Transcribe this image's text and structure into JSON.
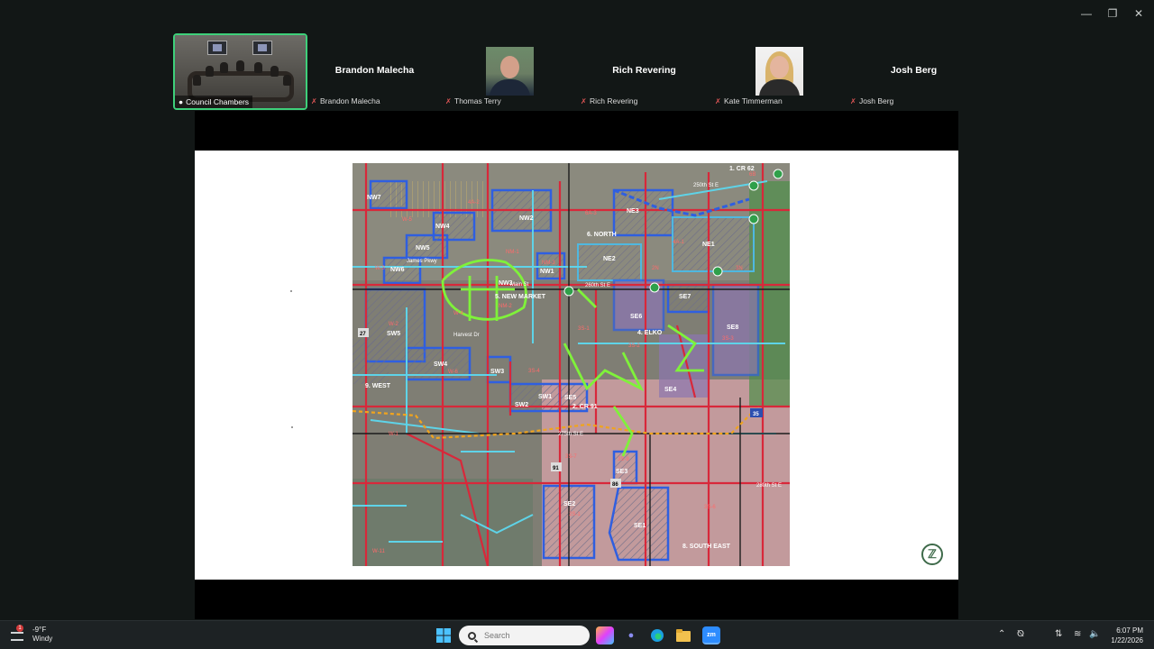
{
  "window": {
    "controls": {
      "minimize": "—",
      "maximize": "❐",
      "close": "✕"
    }
  },
  "participants": {
    "active": {
      "label": "Council Chambers"
    },
    "tiles": [
      {
        "big_name": "Brandon Malecha",
        "label": "Brandon Malecha",
        "has_video": false
      },
      {
        "big_name": "",
        "label": "Thomas Terry",
        "has_video": true
      },
      {
        "big_name": "Rich Revering",
        "label": "Rich Revering",
        "has_video": false
      },
      {
        "big_name": "",
        "label": "Kate Timmerman",
        "has_video": true
      },
      {
        "big_name": "Josh Berg",
        "label": "Josh Berg",
        "has_video": false
      }
    ]
  },
  "map": {
    "roads": {
      "cr62": "CR 62",
      "s250": "250th St E",
      "s260": "260th St E",
      "s275": "275th St E",
      "s280": "280th St E",
      "dakota": "Dakota Ave",
      "natchez": "Natchez Ave",
      "james": "James Pkwy",
      "harvest": "Harvest Dr",
      "dupont": "Dupont Ave",
      "main": "Main St",
      "cr91": "CR 91",
      "i35": "35",
      "hwy": "91",
      "h86": "86",
      "h27": "27"
    },
    "areas": {
      "north": "6. NORTH",
      "new_market": "5. NEW MARKET",
      "elko": "4. ELKO",
      "west": "9. WEST",
      "cr91_area": "2. CR 91",
      "south_east": "8. SOUTH EAST",
      "cr62_area": "1. CR 62"
    },
    "districts": {
      "nw7": "NW7",
      "nw2": "NW2",
      "nw4": "NW4",
      "nw5": "NW5",
      "nw6": "NW6",
      "nw3": "NW3",
      "nw1": "NW1",
      "ne3": "NE3",
      "ne1": "NE1",
      "ne2": "NE2",
      "se7": "SE7",
      "se6": "SE6",
      "se8": "SE8",
      "se4": "SE4",
      "se5": "SE5",
      "se3": "SE3",
      "se2": "SE2",
      "se1": "SE1",
      "sw5": "SW5",
      "sw4": "SW4",
      "sw3": "SW3",
      "sw1": "SW1",
      "sw2": "SW2"
    },
    "codes": {
      "w5": "W-5",
      "w3": "W-3",
      "w2": "W-2",
      "w4": "W-4",
      "w6": "W-6",
      "w1": "W-1",
      "w11": "W-11",
      "a4": "4A-2",
      "a4b": "6A-3",
      "a4c": "4A-1",
      "ne2c": "2N",
      "ne3c": "3N",
      "s1": "3S-1",
      "s2": "3S-2",
      "s3": "3S-3",
      "s4": "3S-4",
      "s7": "3S-7",
      "s6": "3S-6",
      "s9": "3S-9",
      "se2a": "2S-1",
      "nm1": "NM-1",
      "nm2": "NM-2",
      "nm3": "NM-3",
      "e6": "6B"
    }
  },
  "taskbar": {
    "weather": {
      "temp": "-9°F",
      "condition": "Windy",
      "badge": "1"
    },
    "search_placeholder": "Search",
    "clock": {
      "time": "6:07 PM",
      "date": "1/22/2026"
    }
  }
}
